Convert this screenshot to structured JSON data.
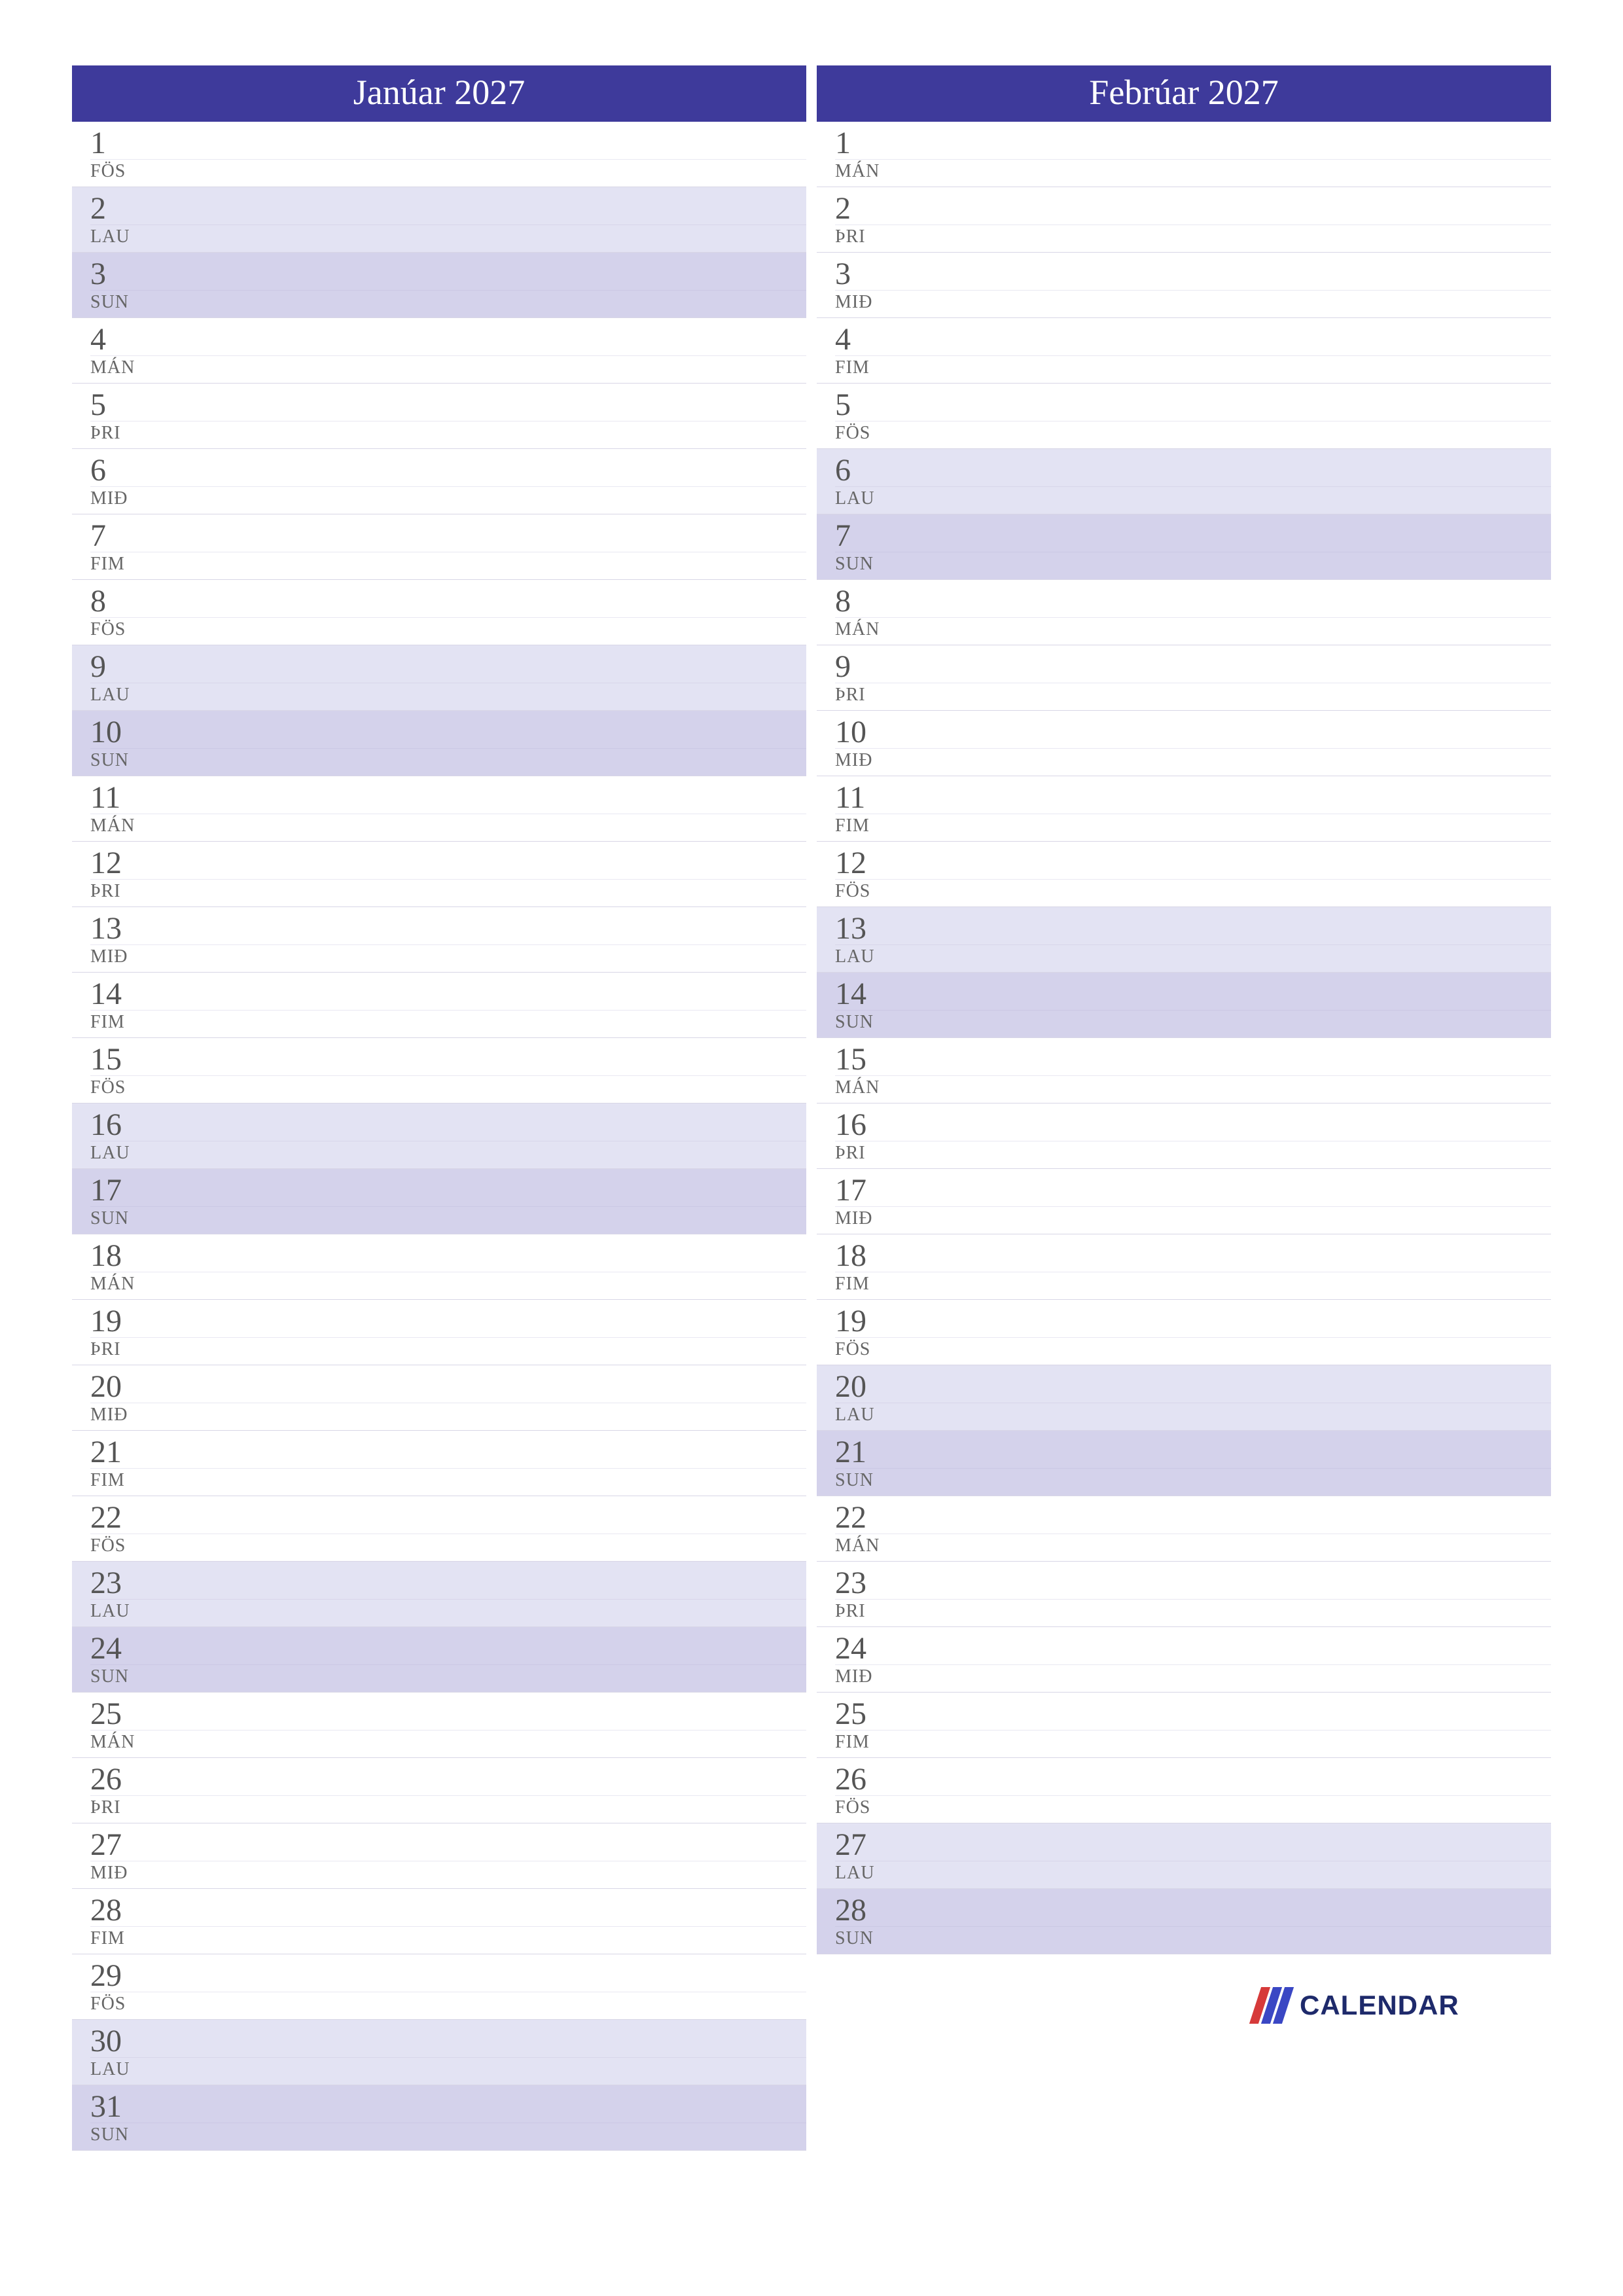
{
  "brand": {
    "name": "CALENDAR"
  },
  "weekday_labels": {
    "mon": "MÁN",
    "tue": "ÞRI",
    "wed": "MIÐ",
    "thu": "FIM",
    "fri": "FÖS",
    "sat": "LAU",
    "sun": "SUN"
  },
  "columns": [
    {
      "title": "Janúar 2027",
      "days": [
        {
          "num": "1",
          "wd": "fri"
        },
        {
          "num": "2",
          "wd": "sat"
        },
        {
          "num": "3",
          "wd": "sun"
        },
        {
          "num": "4",
          "wd": "mon"
        },
        {
          "num": "5",
          "wd": "tue"
        },
        {
          "num": "6",
          "wd": "wed"
        },
        {
          "num": "7",
          "wd": "thu"
        },
        {
          "num": "8",
          "wd": "fri"
        },
        {
          "num": "9",
          "wd": "sat"
        },
        {
          "num": "10",
          "wd": "sun"
        },
        {
          "num": "11",
          "wd": "mon"
        },
        {
          "num": "12",
          "wd": "tue"
        },
        {
          "num": "13",
          "wd": "wed"
        },
        {
          "num": "14",
          "wd": "thu"
        },
        {
          "num": "15",
          "wd": "fri"
        },
        {
          "num": "16",
          "wd": "sat"
        },
        {
          "num": "17",
          "wd": "sun"
        },
        {
          "num": "18",
          "wd": "mon"
        },
        {
          "num": "19",
          "wd": "tue"
        },
        {
          "num": "20",
          "wd": "wed"
        },
        {
          "num": "21",
          "wd": "thu"
        },
        {
          "num": "22",
          "wd": "fri"
        },
        {
          "num": "23",
          "wd": "sat"
        },
        {
          "num": "24",
          "wd": "sun"
        },
        {
          "num": "25",
          "wd": "mon"
        },
        {
          "num": "26",
          "wd": "tue"
        },
        {
          "num": "27",
          "wd": "wed"
        },
        {
          "num": "28",
          "wd": "thu"
        },
        {
          "num": "29",
          "wd": "fri"
        },
        {
          "num": "30",
          "wd": "sat"
        },
        {
          "num": "31",
          "wd": "sun"
        }
      ]
    },
    {
      "title": "Febrúar 2027",
      "days": [
        {
          "num": "1",
          "wd": "mon"
        },
        {
          "num": "2",
          "wd": "tue"
        },
        {
          "num": "3",
          "wd": "wed"
        },
        {
          "num": "4",
          "wd": "thu"
        },
        {
          "num": "5",
          "wd": "fri"
        },
        {
          "num": "6",
          "wd": "sat"
        },
        {
          "num": "7",
          "wd": "sun"
        },
        {
          "num": "8",
          "wd": "mon"
        },
        {
          "num": "9",
          "wd": "tue"
        },
        {
          "num": "10",
          "wd": "wed"
        },
        {
          "num": "11",
          "wd": "thu"
        },
        {
          "num": "12",
          "wd": "fri"
        },
        {
          "num": "13",
          "wd": "sat"
        },
        {
          "num": "14",
          "wd": "sun"
        },
        {
          "num": "15",
          "wd": "mon"
        },
        {
          "num": "16",
          "wd": "tue"
        },
        {
          "num": "17",
          "wd": "wed"
        },
        {
          "num": "18",
          "wd": "thu"
        },
        {
          "num": "19",
          "wd": "fri"
        },
        {
          "num": "20",
          "wd": "sat"
        },
        {
          "num": "21",
          "wd": "sun"
        },
        {
          "num": "22",
          "wd": "mon"
        },
        {
          "num": "23",
          "wd": "tue"
        },
        {
          "num": "24",
          "wd": "wed"
        },
        {
          "num": "25",
          "wd": "thu"
        },
        {
          "num": "26",
          "wd": "fri"
        },
        {
          "num": "27",
          "wd": "sat"
        },
        {
          "num": "28",
          "wd": "sun"
        }
      ]
    }
  ]
}
